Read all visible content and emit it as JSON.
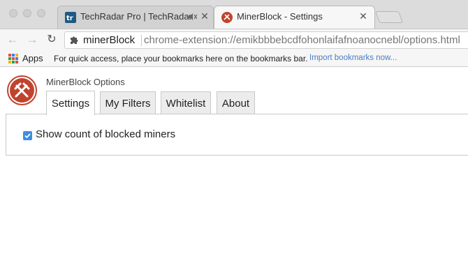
{
  "window": {
    "tabs": [
      {
        "title": "TechRadar Pro | TechRadar",
        "favicon": "techradar-icon",
        "muted": true,
        "active": false
      },
      {
        "title": "MinerBlock - Settings",
        "favicon": "minerblock-icon",
        "active": true
      }
    ],
    "close_glyph": "✕"
  },
  "toolbar": {
    "back_glyph": "←",
    "forward_glyph": "→",
    "reload_glyph": "↻",
    "site_name": "minerBlock",
    "url": "chrome-extension://emikbbbebcdfohonlaifafnoanocnebl/options.html",
    "site_icon": "puzzle-icon"
  },
  "bookmarks": {
    "apps_label": "Apps",
    "hint": "For quick access, place your bookmarks here on the bookmarks bar.",
    "import_link": "Import bookmarks now..."
  },
  "page": {
    "title": "MinerBlock Options",
    "tabs": [
      {
        "label": "Settings",
        "selected": true
      },
      {
        "label": "My Filters",
        "selected": false
      },
      {
        "label": "Whitelist",
        "selected": false
      },
      {
        "label": "About",
        "selected": false
      }
    ],
    "settings": {
      "show_count_label": "Show count of blocked miners",
      "show_count_checked": true
    }
  },
  "colors": {
    "accent": "#3b8ee3",
    "logo_red": "#c0432e",
    "link": "#4a7bc4"
  }
}
